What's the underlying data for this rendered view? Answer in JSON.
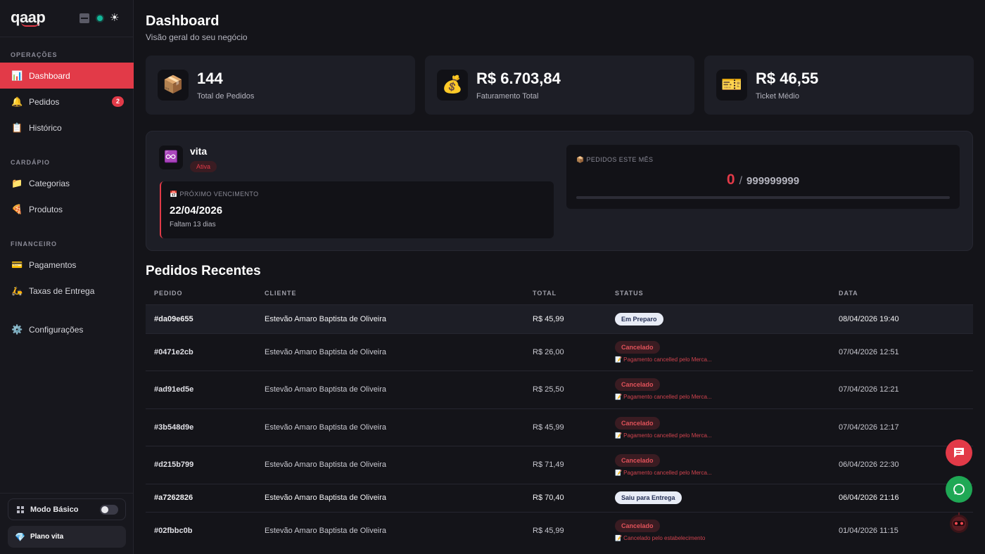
{
  "sidebar": {
    "logo": "qaap",
    "sections": {
      "operacoes": "OPERAÇÕES",
      "cardapio": "CARDÁPIO",
      "financeiro": "FINANCEIRO"
    },
    "items": [
      {
        "label": "Dashboard",
        "icon": "📊"
      },
      {
        "label": "Pedidos",
        "icon": "🔔",
        "badge": "2"
      },
      {
        "label": "Histórico",
        "icon": "📋"
      },
      {
        "label": "Categorias",
        "icon": "📁"
      },
      {
        "label": "Produtos",
        "icon": "🍕"
      },
      {
        "label": "Pagamentos",
        "icon": "💳"
      },
      {
        "label": "Taxas de Entrega",
        "icon": "🛵"
      },
      {
        "label": "Configurações",
        "icon": "⚙️"
      }
    ],
    "modo_basico": "Modo Básico",
    "plano": "Plano vita",
    "plano_icon": "💎"
  },
  "header": {
    "title": "Dashboard",
    "subtitle": "Visão geral do seu negócio"
  },
  "stats": [
    {
      "value": "144",
      "label": "Total de Pedidos",
      "icon": "📦"
    },
    {
      "value": "R$ 6.703,84",
      "label": "Faturamento Total",
      "icon": "💰"
    },
    {
      "value": "R$ 46,55",
      "label": "Ticket Médio",
      "icon": "🎫"
    }
  ],
  "plan": {
    "icon": "♾️",
    "name": "vita",
    "status": "Ativa",
    "due_label": "📅 PRÓXIMO VENCIMENTO",
    "due_date": "22/04/2026",
    "due_days": "Faltam 13 dias",
    "month_label": "📦 PEDIDOS ESTE MÊS",
    "month_current": "0",
    "month_sep": "/",
    "month_max": "999999999",
    "month_progress": 0
  },
  "orders": {
    "title": "Pedidos Recentes",
    "columns": [
      "PEDIDO",
      "CLIENTE",
      "TOTAL",
      "STATUS",
      "DATA"
    ],
    "rows": [
      {
        "id": "#da09e655",
        "client": "Estevão Amaro Baptista de Oliveira",
        "total": "R$ 45,99",
        "status": "Em Preparo",
        "note": "",
        "date": "08/04/2026 19:40"
      },
      {
        "id": "#0471e2cb",
        "client": "Estevão Amaro Baptista de Oliveira",
        "total": "R$ 26,00",
        "status": "Cancelado",
        "note": "📝 Pagamento cancelled pelo Merca...",
        "date": "07/04/2026 12:51"
      },
      {
        "id": "#ad91ed5e",
        "client": "Estevão Amaro Baptista de Oliveira",
        "total": "R$ 25,50",
        "status": "Cancelado",
        "note": "📝 Pagamento cancelled pelo Merca...",
        "date": "07/04/2026 12:21"
      },
      {
        "id": "#3b548d9e",
        "client": "Estevão Amaro Baptista de Oliveira",
        "total": "R$ 45,99",
        "status": "Cancelado",
        "note": "📝 Pagamento cancelled pelo Merca...",
        "date": "07/04/2026 12:17"
      },
      {
        "id": "#d215b799",
        "client": "Estevão Amaro Baptista de Oliveira",
        "total": "R$ 71,49",
        "status": "Cancelado",
        "note": "📝 Pagamento cancelled pelo Merca...",
        "date": "06/04/2026 22:30"
      },
      {
        "id": "#a7262826",
        "client": "Estevão Amaro Baptista de Oliveira",
        "total": "R$ 70,40",
        "status": "Saiu para Entrega",
        "note": "",
        "date": "06/04/2026 21:16"
      },
      {
        "id": "#02fbbc0b",
        "client": "Estevão Amaro Baptista de Oliveira",
        "total": "R$ 45,99",
        "status": "Cancelado",
        "note": "📝 Cancelado pelo estabelecimento",
        "date": "01/04/2026 11:15"
      }
    ]
  },
  "colors": {
    "accent": "#e23a48",
    "background": "#141419",
    "card": "#1d1e26",
    "whatsapp": "#1fa855"
  }
}
